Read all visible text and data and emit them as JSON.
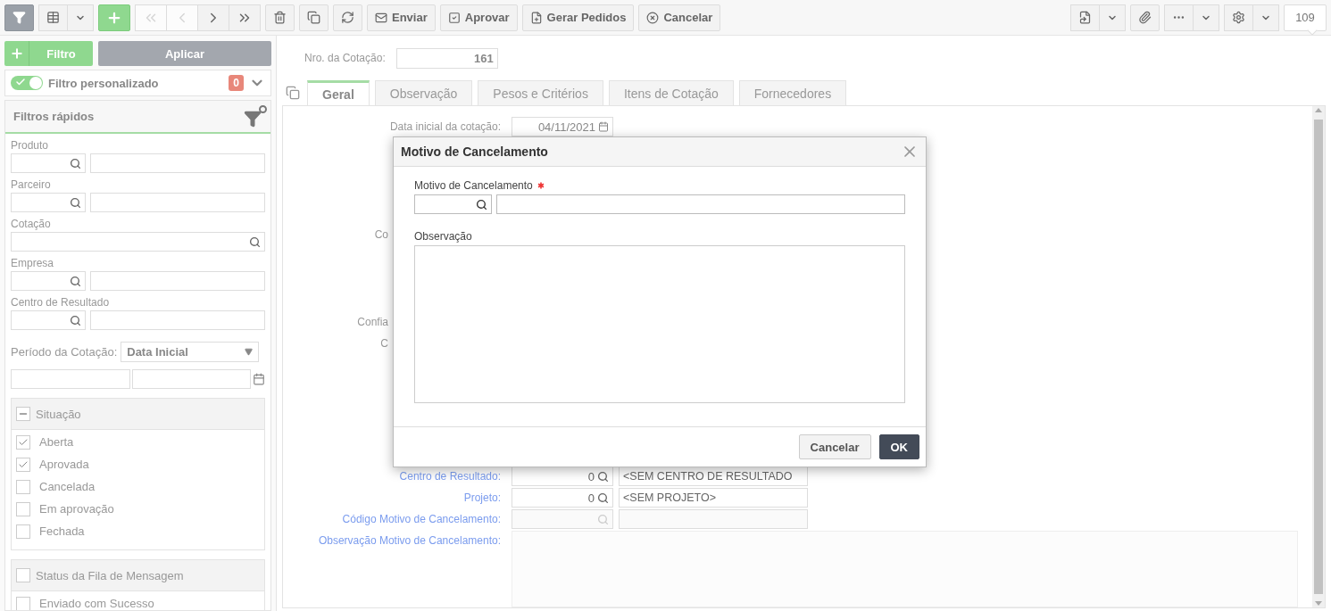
{
  "toolbar": {
    "filter_active": true,
    "nav": [
      {
        "disabled": true
      },
      {
        "disabled": true
      },
      {
        "disabled": false
      },
      {
        "disabled": false
      }
    ],
    "actions": [
      {
        "label": "Enviar"
      },
      {
        "label": "Aprovar"
      },
      {
        "label": "Gerar Pedidos"
      },
      {
        "label": "Cancelar"
      }
    ],
    "counter": "109"
  },
  "sidebar": {
    "filter_button": "Filtro",
    "apply_button": "Aplicar",
    "custom_filter": {
      "label": "Filtro personalizado",
      "on": true,
      "count": "0"
    },
    "quick_filters": {
      "title": "Filtros rápidos",
      "fields": [
        {
          "label": "Produto",
          "kind": "lookup"
        },
        {
          "label": "Parceiro",
          "kind": "lookup"
        },
        {
          "label": "Cotação",
          "kind": "search"
        },
        {
          "label": "Empresa",
          "kind": "lookup"
        },
        {
          "label": "Centro de Resultado",
          "kind": "lookup"
        }
      ],
      "period": {
        "label": "Período da Cotação:",
        "value": "Data Inicial"
      },
      "groups": [
        {
          "title": "Situação",
          "indeterminate": true,
          "options": [
            {
              "label": "Aberta",
              "checked": true
            },
            {
              "label": "Aprovada",
              "checked": true
            },
            {
              "label": "Cancelada",
              "checked": false
            },
            {
              "label": "Em aprovação",
              "checked": false
            },
            {
              "label": "Fechada",
              "checked": false
            }
          ]
        },
        {
          "title": "Status da Fila de Mensagem",
          "indeterminate": false,
          "options": [
            {
              "label": "Enviado com Sucesso",
              "checked": false
            }
          ]
        }
      ]
    }
  },
  "main": {
    "quote_number": {
      "label": "Nro. da Cotação:",
      "value": "161"
    },
    "tabs": [
      {
        "label": "Geral",
        "selected": true
      },
      {
        "label": "Observação",
        "selected": false
      },
      {
        "label": "Pesos e Critérios",
        "selected": false
      },
      {
        "label": "Itens de Cotação",
        "selected": false
      },
      {
        "label": "Fornecedores",
        "selected": false
      }
    ],
    "form": [
      {
        "kind": "date",
        "label": "Data inicial da cotação:",
        "value": "04/11/2021"
      },
      {
        "kind": "fragment",
        "label": "Co"
      },
      {
        "kind": "fragment",
        "label": "Confia"
      },
      {
        "kind": "fragment",
        "label": "C"
      },
      {
        "kind": "lookup",
        "label": "Centro de Resultado:",
        "code": "0",
        "description": "<SEM CENTRO DE RESULTADO",
        "disabled": false
      },
      {
        "kind": "lookup",
        "label": "Projeto:",
        "code": "0",
        "description": "<SEM PROJETO>",
        "disabled": false
      },
      {
        "kind": "lookup",
        "label": "Código Motivo de Cancelamento:",
        "disabled": true
      },
      {
        "kind": "textarea",
        "label": "Observação Motivo de Cancelamento:"
      }
    ]
  },
  "modal": {
    "title": "Motivo de Cancelamento",
    "fields": [
      {
        "kind": "lookup",
        "label": "Motivo de Cancelamento",
        "required": true
      },
      {
        "kind": "textarea",
        "label": "Observação",
        "required": false
      }
    ],
    "buttons": [
      {
        "label": "Cancelar",
        "primary": false
      },
      {
        "label": "OK",
        "primary": true
      }
    ]
  }
}
